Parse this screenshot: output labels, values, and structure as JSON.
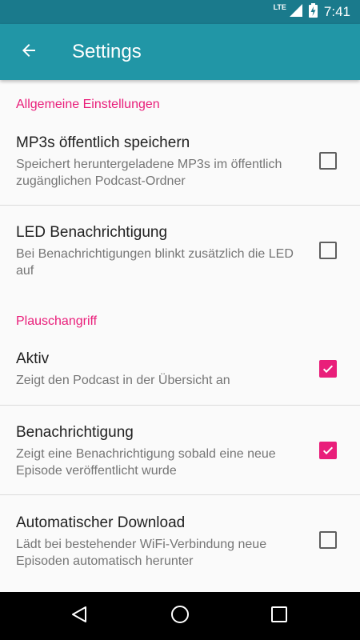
{
  "status_bar": {
    "network": "LTE",
    "time": "7:41"
  },
  "app_bar": {
    "title": "Settings"
  },
  "sections": [
    {
      "header": "Allgemeine Einstellungen",
      "items": [
        {
          "title": "MP3s öffentlich speichern",
          "summary": "Speichert heruntergeladene MP3s im öffentlich zugänglichen Podcast-Ordner",
          "checked": false
        },
        {
          "title": "LED Benachrichtigung",
          "summary": "Bei Benachrichtigungen blinkt zusätzlich die LED auf",
          "checked": false
        }
      ]
    },
    {
      "header": "Plauschangriff",
      "items": [
        {
          "title": "Aktiv",
          "summary": "Zeigt den Podcast in der Übersicht an",
          "checked": true
        },
        {
          "title": "Benachrichtigung",
          "summary": "Zeigt eine Benachrichtigung sobald eine neue Episode veröffentlicht wurde",
          "checked": true
        },
        {
          "title": "Automatischer Download",
          "summary": "Lädt bei bestehender WiFi-Verbindung neue Episoden automatisch herunter",
          "checked": false
        }
      ]
    }
  ],
  "icons": {
    "back": "arrow-back-icon",
    "signal": "signal-icon",
    "battery": "battery-charging-icon",
    "nav_back": "nav-back-icon",
    "nav_home": "nav-home-icon",
    "nav_recents": "nav-recents-icon"
  },
  "colors": {
    "status_bar": "#1a7a8c",
    "app_bar": "#2196a6",
    "accent": "#e91e7a",
    "background": "#fafafa"
  }
}
